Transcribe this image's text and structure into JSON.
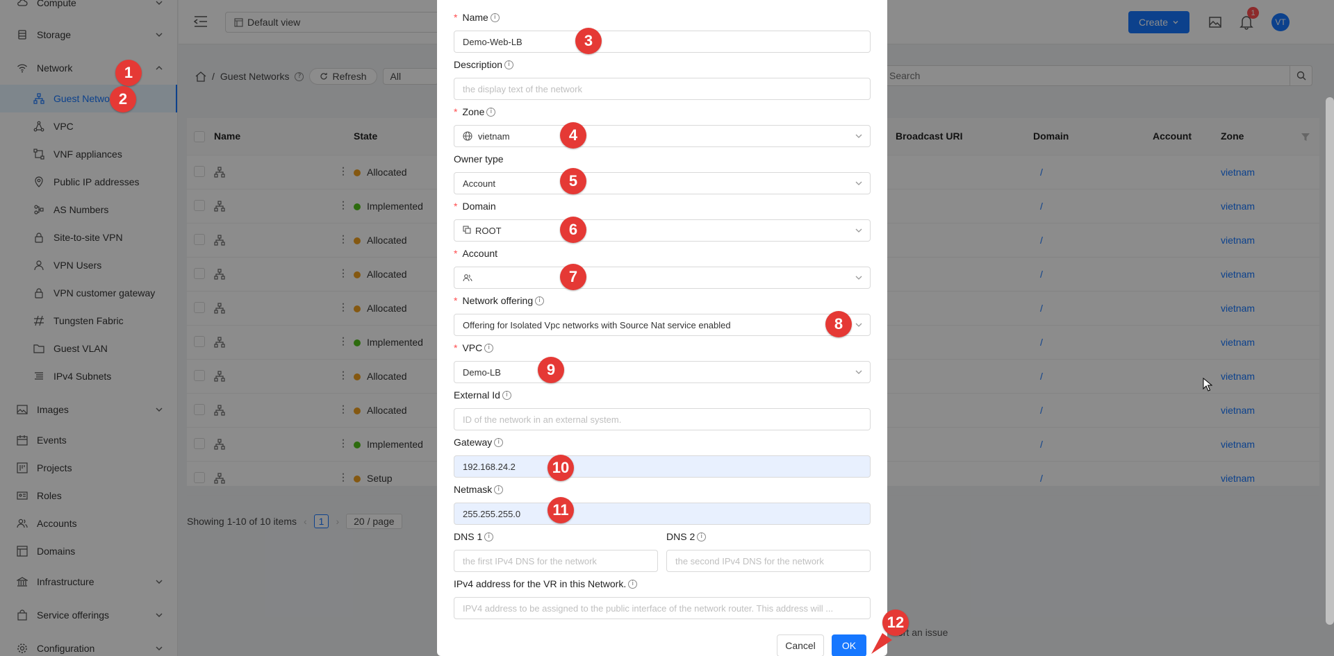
{
  "sidebar": {
    "items": [
      {
        "label": "Compute",
        "icon": "cloud-icon",
        "chevron": true
      },
      {
        "label": "Storage",
        "icon": "database-icon",
        "chevron": true
      },
      {
        "label": "Network",
        "icon": "wifi-icon",
        "chevron": true
      },
      {
        "label": "Guest Networks",
        "icon": "network-icon",
        "sub": true,
        "active": true
      },
      {
        "label": "VPC",
        "icon": "vpc-icon",
        "sub": true
      },
      {
        "label": "VNF appliances",
        "icon": "gateway-icon",
        "sub": true
      },
      {
        "label": "Public IP addresses",
        "icon": "location-icon",
        "sub": true
      },
      {
        "label": "AS Numbers",
        "icon": "nodes-icon",
        "sub": true
      },
      {
        "label": "Site-to-site VPN",
        "icon": "lock-icon",
        "sub": true
      },
      {
        "label": "VPN Users",
        "icon": "user-icon",
        "sub": true
      },
      {
        "label": "VPN customer gateway",
        "icon": "lock-icon",
        "sub": true
      },
      {
        "label": "Tungsten Fabric",
        "icon": "fabric-icon",
        "sub": true
      },
      {
        "label": "Guest VLAN",
        "icon": "folder-icon",
        "sub": true
      },
      {
        "label": "IPv4 Subnets",
        "icon": "subnet-icon",
        "sub": true
      },
      {
        "label": "Images",
        "icon": "image-icon",
        "chevron": true
      },
      {
        "label": "Events",
        "icon": "calendar-icon"
      },
      {
        "label": "Projects",
        "icon": "project-icon"
      },
      {
        "label": "Roles",
        "icon": "id-card-icon"
      },
      {
        "label": "Accounts",
        "icon": "team-icon"
      },
      {
        "label": "Domains",
        "icon": "domain-icon"
      },
      {
        "label": "Infrastructure",
        "icon": "bank-icon",
        "chevron": true
      },
      {
        "label": "Service offerings",
        "icon": "shopping-icon",
        "chevron": true
      },
      {
        "label": "Configuration",
        "icon": "gear-icon",
        "chevron": true
      }
    ]
  },
  "topbar": {
    "view_label": "Default view",
    "create_label": "Create",
    "notification_count": "1",
    "avatar_initials": "VT"
  },
  "content": {
    "breadcrumb": "Guest Networks",
    "refresh_label": "Refresh",
    "filter_value": "All",
    "search_placeholder": "Search",
    "columns": [
      "Name",
      "State",
      "Broadcast URI",
      "Domain",
      "Account",
      "Zone"
    ],
    "rows": [
      {
        "state": "Allocated",
        "domain": "/",
        "zone": "vietnam"
      },
      {
        "state": "Implemented",
        "domain": "/",
        "zone": "vietnam"
      },
      {
        "state": "Allocated",
        "domain": "/",
        "zone": "vietnam"
      },
      {
        "state": "Allocated",
        "domain": "/",
        "zone": "vietnam"
      },
      {
        "state": "Allocated",
        "domain": "/",
        "zone": "vietnam"
      },
      {
        "state": "Implemented",
        "domain": "/",
        "zone": "vietnam"
      },
      {
        "state": "Allocated",
        "domain": "/",
        "zone": "vietnam"
      },
      {
        "state": "Allocated",
        "domain": "/",
        "zone": "vietnam"
      },
      {
        "state": "Implemented",
        "domain": "/",
        "zone": "vietnam"
      },
      {
        "state": "Setup",
        "domain": "/",
        "zone": "vietnam"
      }
    ],
    "pagination": {
      "summary": "Showing 1-10 of 10 items",
      "page": "1",
      "page_size": "20 / page"
    },
    "report_issue": "ort an issue"
  },
  "colors": {
    "allocated": "#f0a020",
    "implemented": "#52c41a",
    "setup": "#f0a020",
    "primary": "#1677ff",
    "marker": "#e53935"
  },
  "form": {
    "name": {
      "label": "Name",
      "value": "Demo-Web-LB"
    },
    "description": {
      "label": "Description",
      "placeholder": "the display text of the network"
    },
    "zone": {
      "label": "Zone",
      "value": "vietnam"
    },
    "owner_type": {
      "label": "Owner type",
      "value": "Account"
    },
    "domain": {
      "label": "Domain",
      "value": "ROOT"
    },
    "account": {
      "label": "Account",
      "value": ""
    },
    "network_offering": {
      "label": "Network offering",
      "value": "Offering for Isolated Vpc networks with Source Nat service enabled"
    },
    "vpc": {
      "label": "VPC",
      "value": "Demo-LB"
    },
    "external_id": {
      "label": "External Id",
      "placeholder": "ID of the network in an external system."
    },
    "gateway": {
      "label": "Gateway",
      "value": "192.168.24.2"
    },
    "netmask": {
      "label": "Netmask",
      "value": "255.255.255.0"
    },
    "dns1": {
      "label": "DNS 1",
      "placeholder": "the first IPv4 DNS for the network"
    },
    "dns2": {
      "label": "DNS 2",
      "placeholder": "the second IPv4 DNS for the network"
    },
    "vr_ip": {
      "label": "IPv4 address for the VR in this Network.",
      "placeholder": "IPV4 address to be assigned to the public interface of the network router. This address will ..."
    },
    "cancel_label": "Cancel",
    "ok_label": "OK"
  },
  "markers": [
    "1",
    "2",
    "3",
    "4",
    "5",
    "6",
    "7",
    "8",
    "9",
    "10",
    "11",
    "12"
  ]
}
